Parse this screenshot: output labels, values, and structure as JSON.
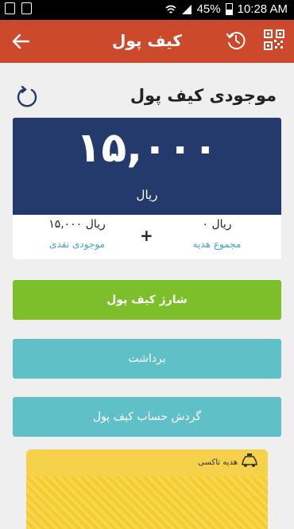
{
  "status_bar": {
    "battery": "45%",
    "time": "10:28 AM"
  },
  "app_bar": {
    "title": "کیف پول"
  },
  "balance": {
    "title": "موجودی کیف پول",
    "amount": "۱۵,۰۰۰",
    "unit": "ریال",
    "cash": {
      "value": "۱۵,۰۰۰ ریال",
      "label": "موجودی نقدی"
    },
    "gift": {
      "value": "۰ ریال",
      "label": "مجموع هدیه"
    },
    "plus": "+"
  },
  "buttons": {
    "charge": "شارژ کیف پول",
    "withdraw": "برداشت",
    "history": "گردش حساب کیف پول"
  },
  "gift_card": {
    "label": "هدیه تاکسی"
  },
  "colors": {
    "app_bar": "#cc4a2b",
    "card_header": "#24396c",
    "charge_button": "#7dbf2b",
    "secondary_button": "#5fc0c8",
    "link_text": "#3fa3c6",
    "gift_card": "#f6d24a"
  }
}
